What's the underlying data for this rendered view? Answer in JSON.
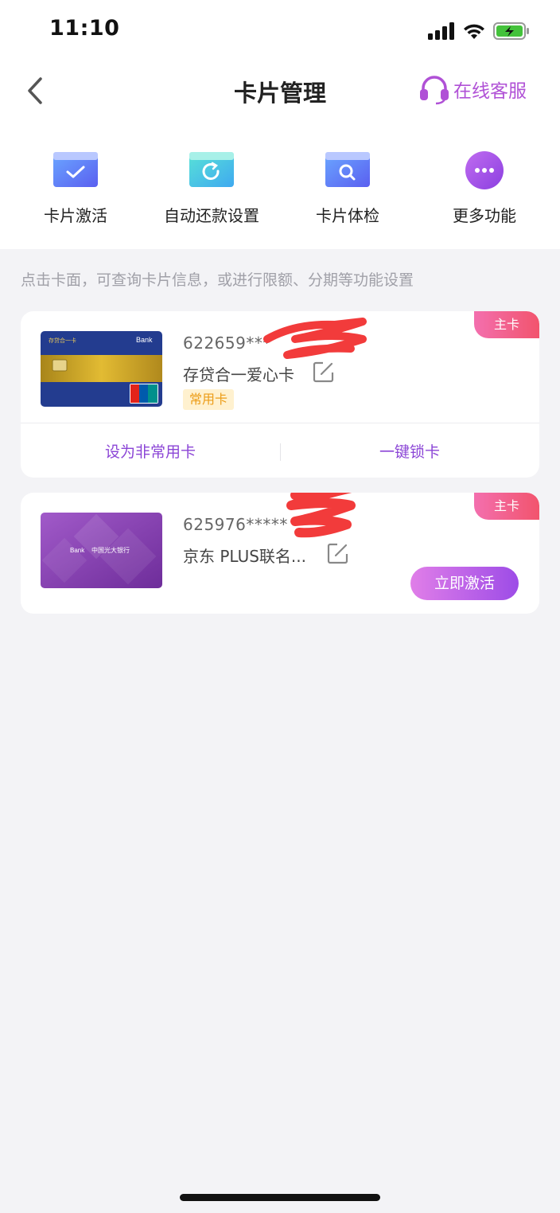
{
  "status": {
    "time": "11:10",
    "battery_color": "#44c23b"
  },
  "nav": {
    "title": "卡片管理",
    "customer_service": "在线客服",
    "accent": "#b051d6"
  },
  "quick_actions": [
    {
      "label": "卡片激活",
      "icon": "card-check-icon"
    },
    {
      "label": "自动还款设置",
      "icon": "card-refresh-icon"
    },
    {
      "label": "卡片体检",
      "icon": "card-search-icon"
    },
    {
      "label": "更多功能",
      "icon": "more-dots-icon"
    }
  ],
  "hint": "点击卡面，可查询卡片信息，或进行限额、分期等功能设置",
  "cards": [
    {
      "badge": "主卡",
      "number": "622659***",
      "name": "存贷合一爱心卡",
      "tag": "常用卡",
      "actions": [
        "设为非常用卡",
        "一键锁卡"
      ]
    },
    {
      "badge": "主卡",
      "number": "625976*****",
      "name": "京东 PLUS联名...",
      "activate_label": "立即激活",
      "card_text": "中国光大银行"
    }
  ]
}
